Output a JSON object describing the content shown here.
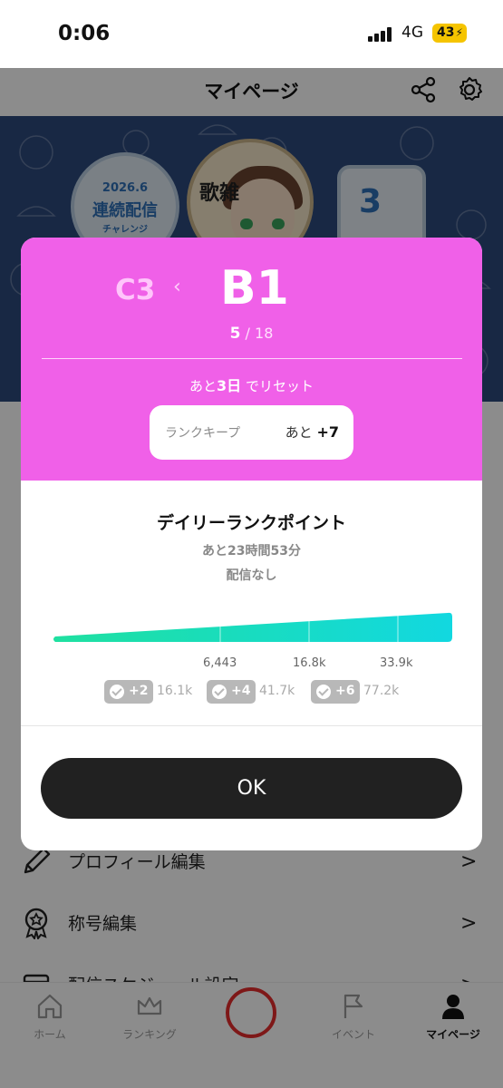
{
  "status_bar": {
    "time": "0:06",
    "network": "4G",
    "battery": "43"
  },
  "header": {
    "title": "マイページ",
    "share_icon": "share-icon",
    "settings_icon": "gear-icon"
  },
  "banner": {
    "challenge_year": "2026.6",
    "challenge_title": "連続配信",
    "challenge_sub": "チャレンジ",
    "song_title": "歌雑",
    "calendar_number": "3"
  },
  "menu": [
    {
      "label": "プロフィール編集",
      "icon": "pencil-icon"
    },
    {
      "label": "称号編集",
      "icon": "medal-icon"
    },
    {
      "label": "配信スケジュール設定",
      "icon": "calendar-icon"
    }
  ],
  "bottom_nav": [
    {
      "label": "ホーム",
      "icon": "home-icon"
    },
    {
      "label": "ランキング",
      "icon": "crown-icon"
    },
    {
      "label": "",
      "icon": "live-icon"
    },
    {
      "label": "イベント",
      "icon": "flag-icon"
    },
    {
      "label": "マイページ",
      "icon": "person-icon"
    }
  ],
  "modal": {
    "prev_rank": "C3",
    "current_rank": "B1",
    "position": "5",
    "total": "/ 18",
    "reset_prefix": "あと",
    "reset_days": "3日",
    "reset_suffix": "でリセット",
    "keep_label": "ランクキープ",
    "keep_prefix": "あと",
    "keep_value": "+7",
    "daily_title": "デイリーランクポイント",
    "daily_time": "あと23時間53分",
    "daily_status": "配信なし",
    "progress_ticks": [
      "6,443",
      "16.8k",
      "33.9k"
    ],
    "rewards": [
      {
        "bonus": "+2",
        "threshold": "16.1k"
      },
      {
        "bonus": "+4",
        "threshold": "41.7k"
      },
      {
        "bonus": "+6",
        "threshold": "77.2k"
      }
    ],
    "ok_label": "OK",
    "colors": {
      "rank_bg": "#f060e8",
      "bar_start": "#1fe0a0",
      "bar_end": "#12d8e0",
      "ok_bg": "#212121"
    }
  }
}
